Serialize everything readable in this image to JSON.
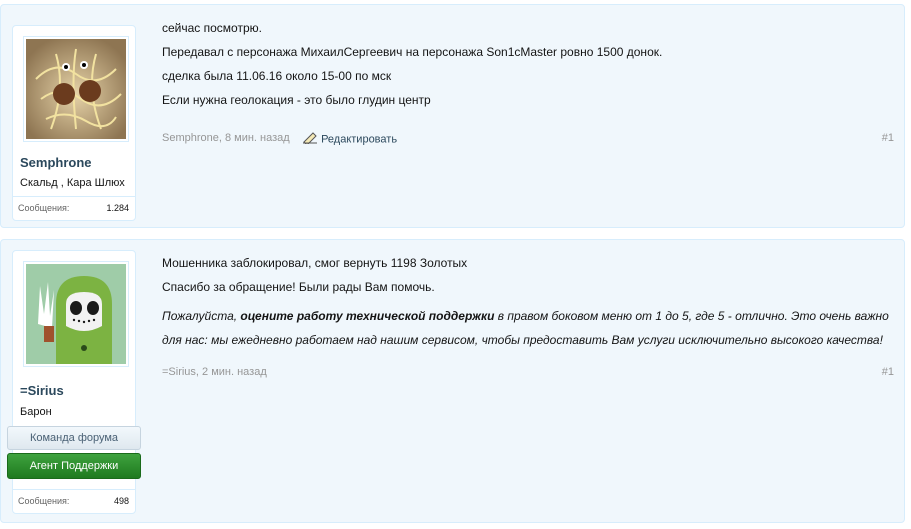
{
  "posts": [
    {
      "username": "Semphrone",
      "user_title": "Скальд , Кара Шлюх",
      "messages_label": "Сообщения:",
      "messages_count": "1.284",
      "lines": [
        "сейчас посмотрю.",
        "Передавал с персонажа МихаилСергеевич на персонажа Son1cMaster ровно 1500 донок.",
        "сделка была 11.06.16 около 15-00 по мск",
        "Если нужна геолокация - это было глудин центр"
      ],
      "meta": "Semphrone, 8 мин. назад",
      "edit_label": "Редактировать",
      "post_number": "#1"
    },
    {
      "username": "=Sirius",
      "user_title": "Барон",
      "badge_team": "Команда форума",
      "badge_support": "Агент Поддержки",
      "messages_label": "Сообщения:",
      "messages_count": "498",
      "lines": [
        "Мошенника заблокировал, смог вернуть 1198 Золотых",
        "Спасибо за обращение! Были рады Вам помочь."
      ],
      "italic_prefix": "Пожалуйста, ",
      "italic_bold": "оцените работу технической поддержки",
      "italic_suffix": " в правом боковом меню от 1 до 5, где 5 - отлично. Это очень важно для нас: мы ежедневно работаем над нашим сервисом, чтобы предоставить Вам услуги исключительно высокого качества!",
      "meta": "=Sirius, 2 мин. назад",
      "post_number": "#1"
    }
  ]
}
